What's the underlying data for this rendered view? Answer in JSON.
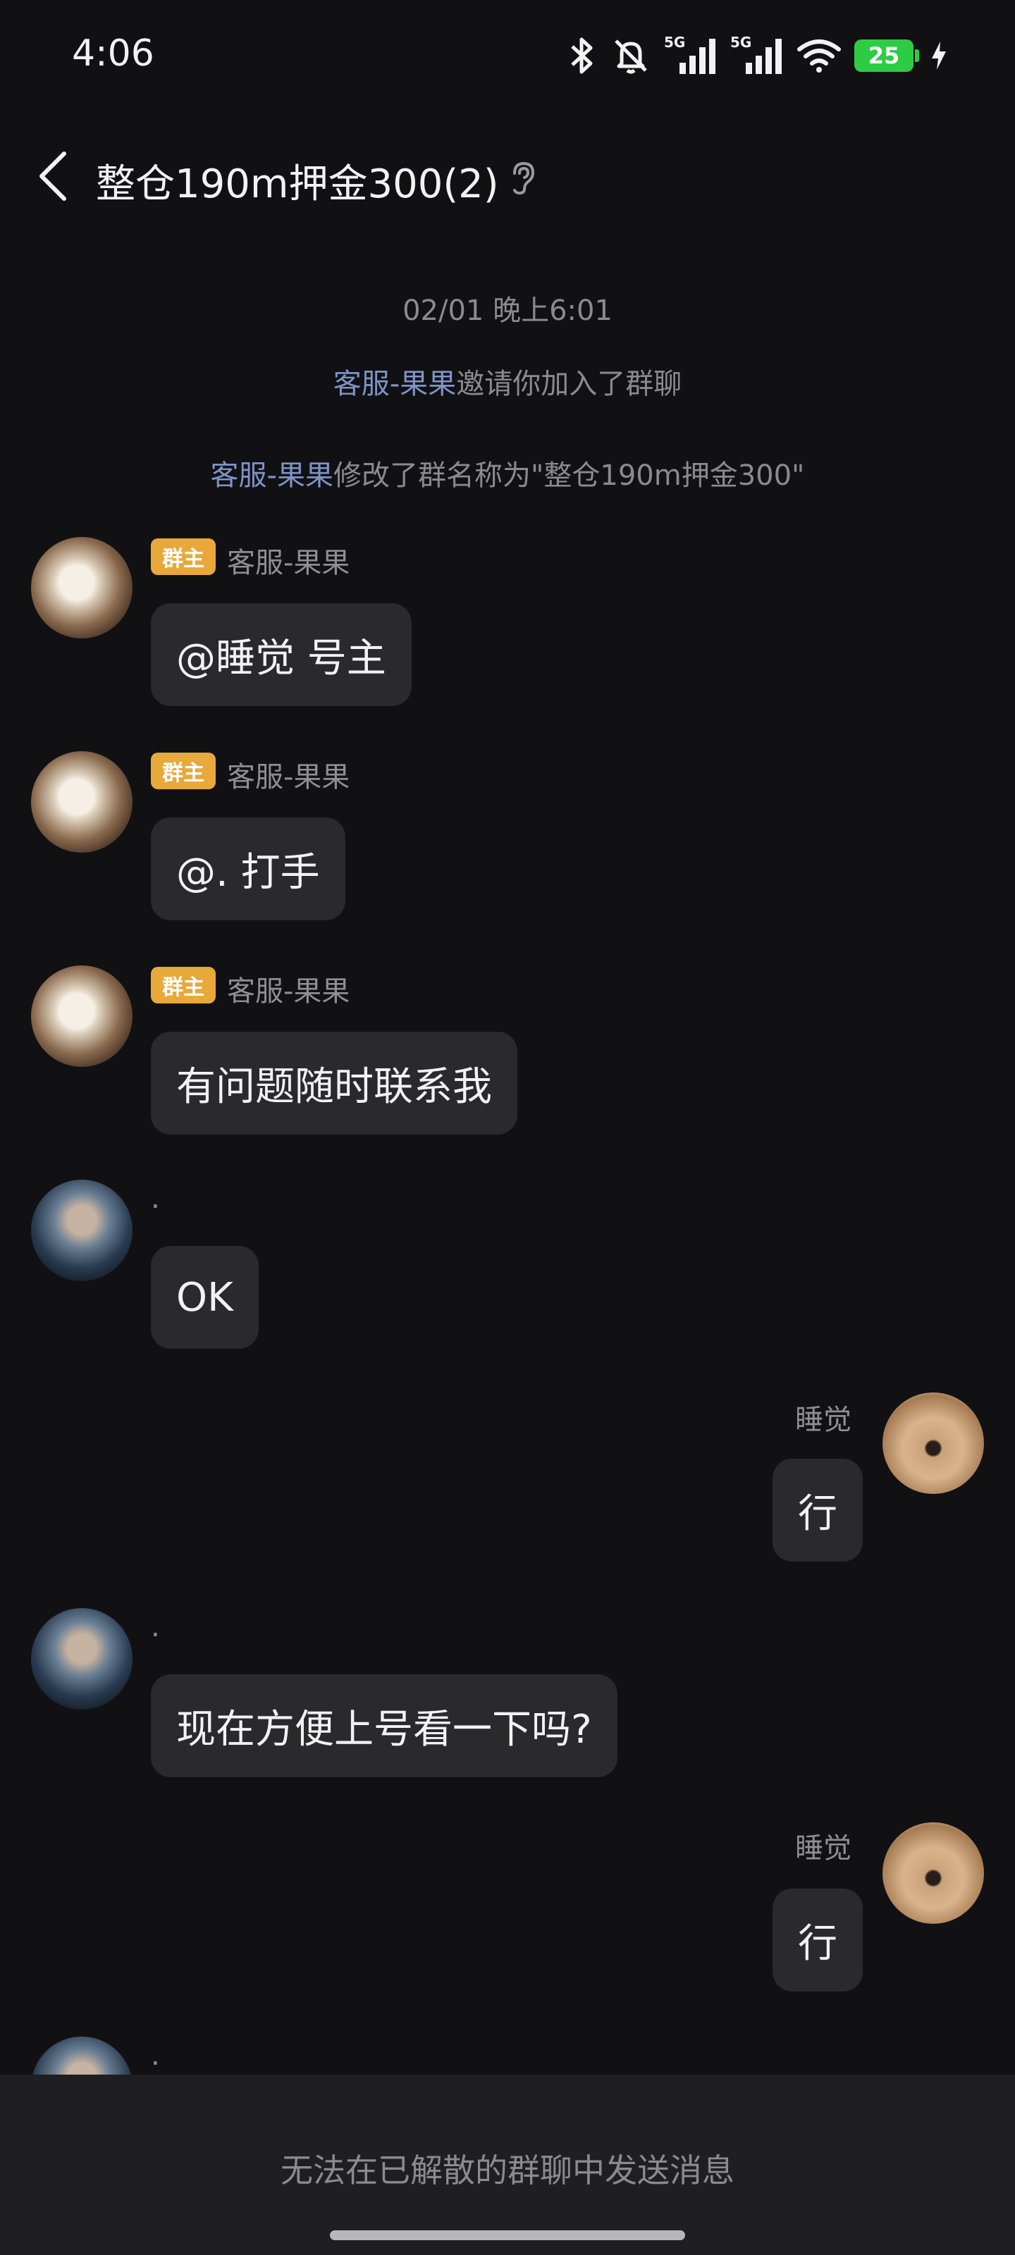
{
  "status_bar": {
    "time": "4:06",
    "battery": "25",
    "icons": [
      "bluetooth-icon",
      "mute-icon",
      "signal-5g-icon",
      "signal-5g-icon",
      "wifi-icon",
      "battery-icon",
      "charging-icon"
    ],
    "network_label": "5G"
  },
  "header": {
    "title": "整仓190m押金300(2)",
    "back_icon": "chevron-left-icon",
    "ear_icon": "ear-icon"
  },
  "notices": {
    "date": "02/01 晚上6:01",
    "invite": {
      "link": "客服-果果",
      "text": "邀请你加入了群聊"
    },
    "rename": {
      "link": "客服-果果",
      "text": "修改了群名称为\"整仓190m押金300\""
    }
  },
  "messages": [
    {
      "side": "left",
      "badge": "群主",
      "sender": "客服-果果",
      "text": "@睡觉 号主",
      "avatar": "cat-avatar"
    },
    {
      "side": "left",
      "badge": "群主",
      "sender": "客服-果果",
      "text": "@. 打手",
      "avatar": "cat-avatar"
    },
    {
      "side": "left",
      "badge": "群主",
      "sender": "客服-果果",
      "text": "有问题随时联系我",
      "avatar": "cat-avatar"
    },
    {
      "side": "left",
      "sender": ".",
      "text": "OK",
      "avatar": "girl-avatar"
    },
    {
      "side": "right",
      "sender": "睡觉",
      "text": "行",
      "avatar": "dog-avatar"
    },
    {
      "side": "left",
      "sender": ".",
      "text": "现在方便上号看一下吗?",
      "avatar": "girl-avatar"
    },
    {
      "side": "right",
      "sender": "睡觉",
      "text": "行",
      "avatar": "dog-avatar"
    },
    {
      "side": "left",
      "sender": ".",
      "text": "",
      "avatar": "girl-avatar"
    }
  ],
  "bottom": {
    "notice": "无法在已解散的群聊中发送消息"
  },
  "colors": {
    "background": "#111113",
    "bubble": "#2a2a2c",
    "badge": "#e8a93a",
    "link": "#7f93c8",
    "battery": "#2ecc45"
  }
}
